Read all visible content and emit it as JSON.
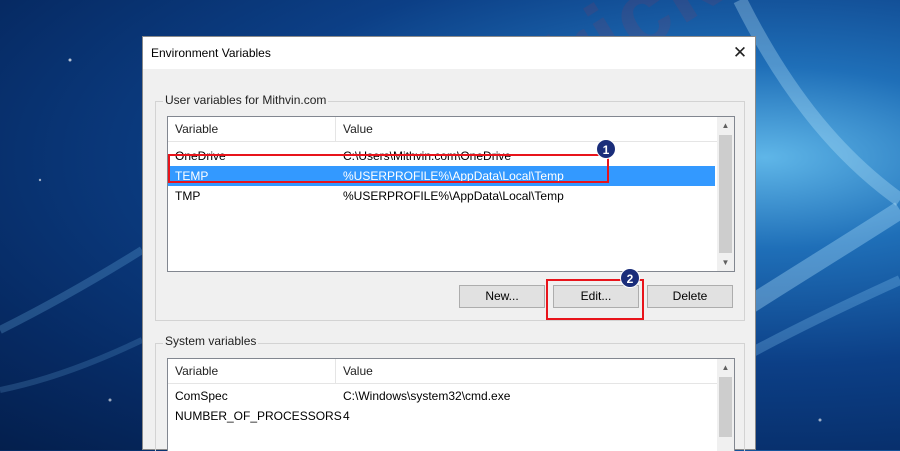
{
  "dialog": {
    "title": "Environment Variables",
    "close_symbol": "✕"
  },
  "user_vars": {
    "group_label": "User variables for Mithvin.com",
    "columns": [
      "Variable",
      "Value"
    ],
    "rows": [
      {
        "variable": "OneDrive",
        "value": "C:\\Users\\Mithvin.com\\OneDrive"
      },
      {
        "variable": "TEMP",
        "value": "%USERPROFILE%\\AppData\\Local\\Temp"
      },
      {
        "variable": "TMP",
        "value": "%USERPROFILE%\\AppData\\Local\\Temp"
      }
    ],
    "selected_row": "TEMP",
    "buttons": {
      "new": "New...",
      "edit": "Edit...",
      "delete": "Delete"
    }
  },
  "system_vars": {
    "group_label": "System variables",
    "columns": [
      "Variable",
      "Value"
    ],
    "rows": [
      {
        "variable": "ComSpec",
        "value": "C:\\Windows\\system32\\cmd.exe"
      },
      {
        "variable": "NUMBER_OF_PROCESSORS",
        "value": "4"
      }
    ]
  },
  "annotations": {
    "step1": "1",
    "step2": "2",
    "highlight_color": "#e8141b",
    "marker_color": "#1a2d7a"
  },
  "watermark": "DeviceTricks",
  "colors": {
    "selection": "#3399ff",
    "desktop_bg": "#0c3f86"
  }
}
